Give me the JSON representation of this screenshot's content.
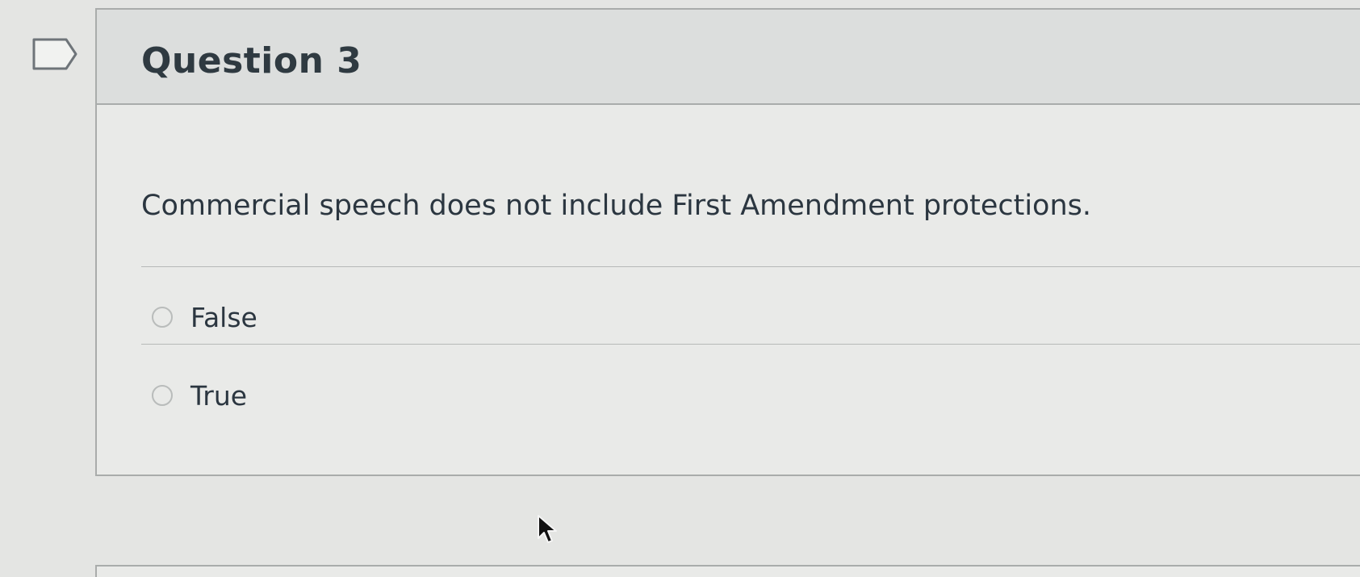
{
  "question": {
    "title": "Question 3",
    "text": "Commercial speech does not include First Amendment protections.",
    "answers": [
      {
        "label": "False",
        "selected": false
      },
      {
        "label": "True",
        "selected": false
      }
    ]
  },
  "icons": {
    "flag": "flag-question-icon",
    "cursor": "mouse-pointer-icon"
  },
  "colors": {
    "background": "#e4e5e3",
    "card_border": "#a9acab",
    "text": "#2b3640"
  }
}
